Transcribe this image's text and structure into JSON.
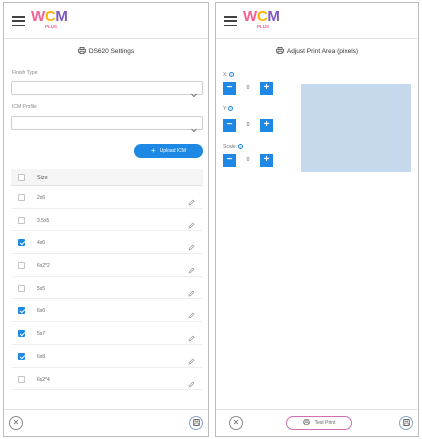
{
  "brand": {
    "logo_w": "W",
    "logo_c": "C",
    "logo_m": "M",
    "logo_sub": "PLUS"
  },
  "left": {
    "title": "DS620 Settings",
    "finish_type_label": "Finish Type",
    "finish_type_value": "",
    "icm_profile_label": "ICM Profile",
    "icm_profile_value": "",
    "upload_label": "Upload ICM",
    "table_header": "Size",
    "rows": [
      {
        "size": "2x6",
        "checked": false
      },
      {
        "size": "3.5x5",
        "checked": false
      },
      {
        "size": "4x6",
        "checked": true
      },
      {
        "size": "6x2*2",
        "checked": false
      },
      {
        "size": "5x5",
        "checked": false
      },
      {
        "size": "6x6",
        "checked": true
      },
      {
        "size": "5x7",
        "checked": true
      },
      {
        "size": "6x8",
        "checked": true
      },
      {
        "size": "6x2*4",
        "checked": false
      }
    ]
  },
  "right": {
    "title": "Adjust Print Area (pixels)",
    "x_label": "X:",
    "x_value": "0",
    "y_label": "Y:",
    "y_value": "0",
    "scale_label": "Scale:",
    "scale_value": "0",
    "test_print_label": "Test Print"
  },
  "colors": {
    "accent": "#1e88e5",
    "preview": "#c5d8ec",
    "test_print_border": "#d26fb4"
  }
}
